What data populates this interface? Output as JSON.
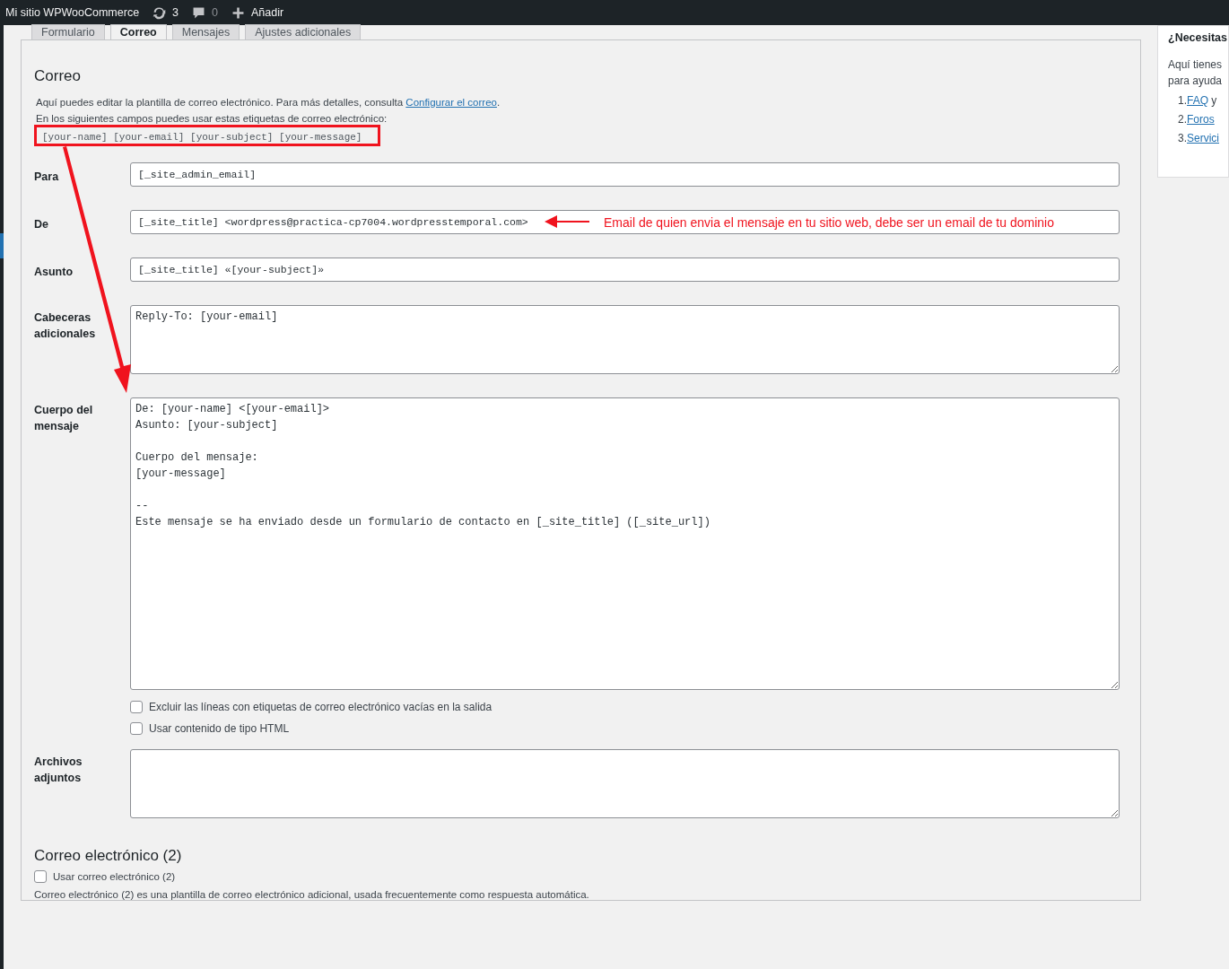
{
  "admin_bar": {
    "site": "Mi sitio WPWooCommerce",
    "updates": "3",
    "comments": "0",
    "add": "Añadir"
  },
  "tabs": [
    {
      "label": "Formulario",
      "selected": false
    },
    {
      "label": "Correo",
      "selected": true
    },
    {
      "label": "Mensajes",
      "selected": false
    },
    {
      "label": "Ajustes adicionales",
      "selected": false
    }
  ],
  "mail": {
    "title": "Correo",
    "description": "Aquí puedes editar la plantilla de correo electrónico. Para más detalles, consulta ",
    "description_link": "Configurar el correo",
    "description_end": ".",
    "tags_intro": "En los siguientes campos puedes usar estas etiquetas de correo electrónico:",
    "tags": "[your-name] [your-email] [your-subject] [your-message]",
    "fields": [
      {
        "label": "Para",
        "kind": "input",
        "value": "[_site_admin_email]"
      },
      {
        "label": "De",
        "kind": "input",
        "value": "[_site_title] <wordpress@practica-cp7004.wordpresstemporal.com>",
        "note": "Email de quien envia el mensaje en tu sitio web, debe ser un email de tu dominio"
      },
      {
        "label": "Asunto",
        "kind": "input",
        "value": "[_site_title] «[your-subject]»"
      },
      {
        "label": "Cabeceras adicionales",
        "kind": "textarea",
        "value": "Reply-To: [your-email]"
      },
      {
        "label": "Cuerpo del mensaje",
        "kind": "textarea-large",
        "value": "De: [your-name] <[your-email]>\nAsunto: [your-subject]\n\nCuerpo del mensaje:\n[your-message]\n\n-- \nEste mensaje se ha enviado desde un formulario de contacto en [_site_title] ([_site_url])",
        "options": [
          {
            "label": "Excluir las líneas con etiquetas de correo electrónico vacías en la salida",
            "checked": false
          },
          {
            "label": "Usar contenido de tipo HTML",
            "checked": false
          }
        ]
      },
      {
        "label": "Archivos adjuntos",
        "kind": "textarea"
      }
    ]
  },
  "mail2": {
    "title": "Correo electrónico (2)",
    "checkbox": {
      "label": "Usar correo electrónico (2)",
      "checked": false
    },
    "description": "Correo electrónico (2) es una plantilla de correo electrónico adicional, usada frecuentemente como respuesta automática."
  },
  "help": {
    "title": "¿Necesitas",
    "text": [
      "Aquí tienes",
      "para ayuda"
    ],
    "items": [
      {
        "number": "1.",
        "link": "FAQ",
        "after": " y"
      },
      {
        "number": "2.",
        "link": "Foros"
      },
      {
        "number": "3.",
        "link": "Servici"
      }
    ]
  }
}
